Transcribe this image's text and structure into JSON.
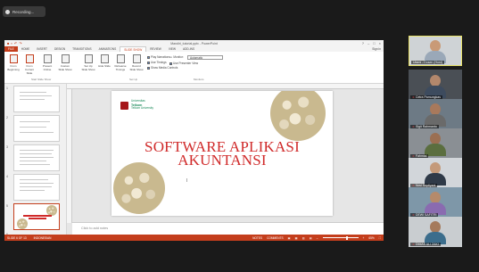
{
  "recording": {
    "label": "Recording..."
  },
  "ppt": {
    "window_title": "Mandiri_tutorial.pptx - PowerPoint",
    "tabs": [
      "FILE",
      "HOME",
      "INSERT",
      "DESIGN",
      "TRANSITIONS",
      "ANIMATIONS",
      "SLIDE SHOW",
      "REVIEW",
      "VIEW",
      "ADD-INS"
    ],
    "active_tab": "SLIDE SHOW",
    "sign_in": "Sign in",
    "ribbon": {
      "buttons": [
        "From Beginning",
        "From Current Slide",
        "Present Online",
        "Custom Slide Show",
        "Set Up Slide Show",
        "Hide Slide",
        "Rehearse Timings",
        "Record Slide Show"
      ],
      "checkboxes": [
        "Play Narrations",
        "Use Timings",
        "Show Media Controls",
        "Use Presenter View"
      ],
      "monitor_label": "Monitor:",
      "monitor_value": "Automatic",
      "groups": [
        "Start Slide Show",
        "Set Up",
        "Monitors"
      ]
    },
    "thumbnail_numbers": [
      "1",
      "2",
      "3",
      "4",
      "5",
      "6"
    ],
    "notes_placeholder": "Click to add notes",
    "slide": {
      "logo_line1": "Universitas",
      "logo_line2": "Telkom",
      "logo_line3": "Telkom University",
      "title_line1": "SOFTWARE APLIKASI",
      "title_line2": "AKUNTANSI"
    },
    "status": {
      "slide_of": "SLIDE 6 OF 13",
      "language": "INDONESIAN",
      "notes": "NOTES",
      "comments": "COMMENTS",
      "zoom": "65%"
    }
  },
  "participants": [
    {
      "name": "Utami - Dosen (Host)",
      "muted": false,
      "active": true,
      "shirt": "#9aa8b8",
      "head": "#c99a77",
      "bg": "#cfd3d6"
    },
    {
      "name": "Cetra Pamungkas",
      "muted": true,
      "active": false,
      "shirt": "#3d4b5e",
      "head": "#b2876c",
      "bg": "#4a4f55"
    },
    {
      "name": "Sigit Rahmanto",
      "muted": true,
      "active": false,
      "shirt": "#6a6a6a",
      "head": "#a8795c",
      "bg": "#6d7a85"
    },
    {
      "name": "Fahmial",
      "muted": true,
      "active": false,
      "shirt": "#5b6e3f",
      "head": "#9b6f52",
      "bg": "#8a8f94"
    },
    {
      "name": "Novi Septiyani",
      "muted": true,
      "active": false,
      "shirt": "#2f3a48",
      "head": "#c49a7a",
      "bg": "#d2d6da"
    },
    {
      "name": "DEWI SAFITRI",
      "muted": true,
      "active": false,
      "shirt": "#8a6bb0",
      "head": "#b58a6b",
      "bg": "#7e97a8"
    },
    {
      "name": "DIMAS ALI ZAKI",
      "muted": true,
      "active": false,
      "shirt": "#3b6d8c",
      "head": "#a57a5c",
      "bg": "#c9cdd0"
    }
  ]
}
